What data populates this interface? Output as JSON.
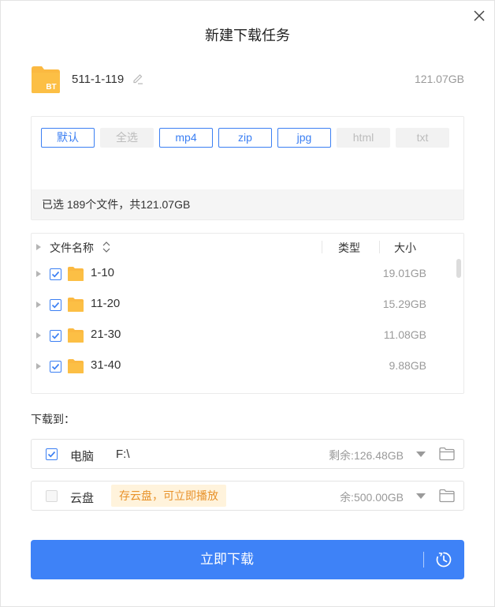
{
  "dialog": {
    "title": "新建下载任务"
  },
  "file": {
    "name": "511-1-119",
    "size": "121.07GB",
    "badge": "BT"
  },
  "filters": {
    "chips": [
      {
        "label": "默认",
        "enabled": true
      },
      {
        "label": "全选",
        "enabled": false
      },
      {
        "label": "mp4",
        "enabled": true
      },
      {
        "label": "zip",
        "enabled": true
      },
      {
        "label": "jpg",
        "enabled": true
      },
      {
        "label": "html",
        "enabled": false
      },
      {
        "label": "txt",
        "enabled": false
      }
    ],
    "summary": "已选 189个文件，共121.07GB"
  },
  "list": {
    "headers": {
      "name": "文件名称",
      "type": "类型",
      "size": "大小"
    },
    "rows": [
      {
        "name": "1-10",
        "size": "19.01GB",
        "checked": true
      },
      {
        "name": "11-20",
        "size": "15.29GB",
        "checked": true
      },
      {
        "name": "21-30",
        "size": "11.08GB",
        "checked": true
      },
      {
        "name": "31-40",
        "size": "9.88GB",
        "checked": true
      }
    ]
  },
  "download_to": {
    "label": "下载到：",
    "pc": {
      "name": "电脑",
      "path": "F:\\",
      "space": "剩余:126.48GB",
      "checked": true
    },
    "cloud": {
      "name": "云盘",
      "promo": "存云盘，可立即播放",
      "space": "余:500.00GB",
      "checked": false
    }
  },
  "action": {
    "label": "立即下载"
  },
  "colors": {
    "accent": "#3e82f7",
    "folder": "#fbb941",
    "promo_bg": "#fff3dc",
    "promo_text": "#e8922a"
  }
}
